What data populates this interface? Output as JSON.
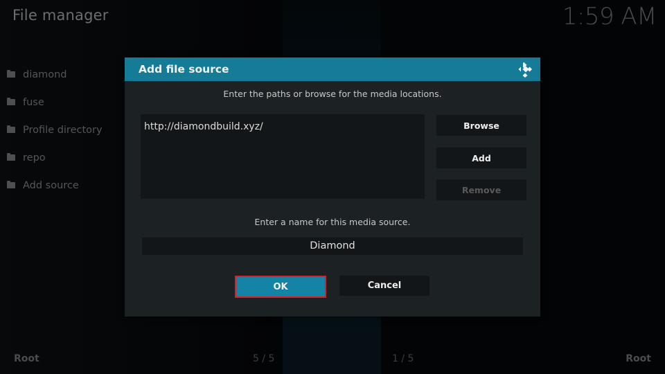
{
  "header": {
    "title": "File manager",
    "clock": "1:59 AM"
  },
  "sidebar": {
    "items": [
      {
        "label": "diamond",
        "icon": "folder-icon"
      },
      {
        "label": "fuse",
        "icon": "folder-icon"
      },
      {
        "label": "Profile directory",
        "icon": "folder-icon"
      },
      {
        "label": "repo",
        "icon": "folder-icon"
      },
      {
        "label": "Add source",
        "icon": "folder-icon"
      }
    ]
  },
  "footer": {
    "left_label": "Root",
    "left_count": "5 / 5",
    "right_count": "1 / 5",
    "right_label": "Root"
  },
  "dialog": {
    "title": "Add file source",
    "logo_icon": "kodi-logo-icon",
    "paths_instruction": "Enter the paths or browse for the media locations.",
    "paths": [
      "http://diamondbuild.xyz/"
    ],
    "buttons": {
      "browse": "Browse",
      "add": "Add",
      "remove": "Remove",
      "ok": "OK",
      "cancel": "Cancel"
    },
    "name_instruction": "Enter a name for this media source.",
    "name_value": "Diamond",
    "colors": {
      "header": "#157b96",
      "ok_focus_border": "#d7202a",
      "ok_bg": "#1383a6"
    }
  }
}
